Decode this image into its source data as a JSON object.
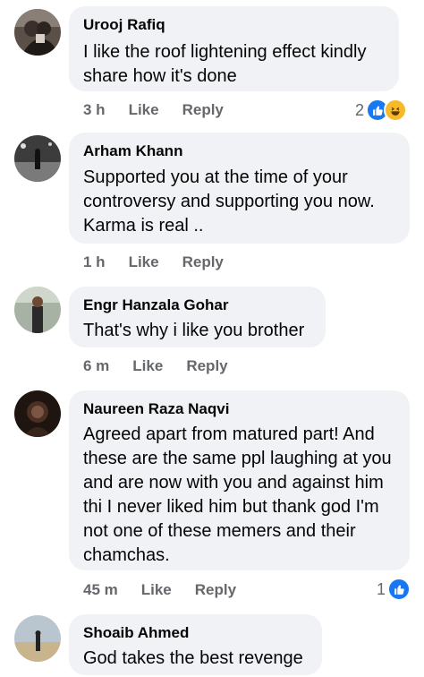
{
  "comments": [
    {
      "author": "Urooj Rafiq",
      "text": "I like the roof lightening effect kindly share how it's done",
      "time": "3 h",
      "like_label": "Like",
      "reply_label": "Reply",
      "reaction_count": "2",
      "reactions": [
        "like-icon",
        "haha-icon"
      ]
    },
    {
      "author": "Arham Khann",
      "text": "Supported you at the time of your controversy and supporting you now. Karma is real ..",
      "time": "1 h",
      "like_label": "Like",
      "reply_label": "Reply"
    },
    {
      "author": "Engr Hanzala Gohar",
      "text": "That's why i like you brother",
      "time": "6 m",
      "like_label": "Like",
      "reply_label": "Reply"
    },
    {
      "author": "Naureen Raza Naqvi",
      "text": "Agreed apart from matured part! And these are the same ppl laughing at you and are now with you and against him thi I never liked him but thank god I'm not one of these memers and their chamchas.",
      "time": "45 m",
      "like_label": "Like",
      "reply_label": "Reply",
      "reaction_count": "1",
      "reactions": [
        "like-icon"
      ]
    },
    {
      "author": "Shoaib Ahmed",
      "text": "God takes the best revenge"
    }
  ],
  "colors": {
    "bubble": "#f0f2f5",
    "meta": "#65676b",
    "like_blue": "#1877f2",
    "haha_yellow": "#f7b928"
  }
}
